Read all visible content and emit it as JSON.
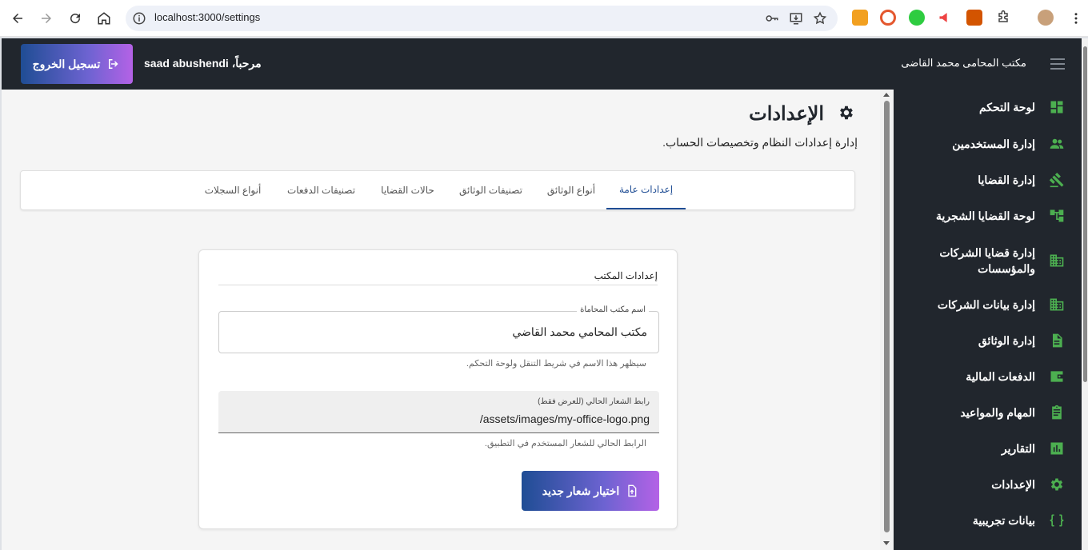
{
  "browser": {
    "url": "localhost:3000/settings"
  },
  "header": {
    "app_title": "مكتب المحامى محمد القاضى",
    "welcome": "مرحباً، saad abushendi",
    "logout_label": "تسجيل الخروج"
  },
  "sidebar": {
    "items": [
      {
        "label": "لوحة التحكم",
        "icon": "dashboard-icon"
      },
      {
        "label": "إدارة المستخدمين",
        "icon": "people-icon"
      },
      {
        "label": "إدارة القضايا",
        "icon": "gavel-icon"
      },
      {
        "label": "لوحة القضايا الشجرية",
        "icon": "account-tree-icon"
      },
      {
        "label": "إدارة قضايا الشركات والمؤسسات",
        "icon": "business-icon"
      },
      {
        "label": "إدارة بيانات الشركات",
        "icon": "business-icon"
      },
      {
        "label": "إدارة الوثائق",
        "icon": "document-icon"
      },
      {
        "label": "الدفعات المالية",
        "icon": "wallet-icon"
      },
      {
        "label": "المهام والمواعيد",
        "icon": "clipboard-icon"
      },
      {
        "label": "التقارير",
        "icon": "bar-chart-icon"
      },
      {
        "label": "الإعدادات",
        "icon": "settings-icon"
      },
      {
        "label": "بيانات تجريبية",
        "icon": "data-object-icon"
      }
    ]
  },
  "page": {
    "title": "الإعدادات",
    "subtitle": "إدارة إعدادات النظام وتخصيصات الحساب."
  },
  "tabs": [
    {
      "label": "إعدادات عامة",
      "active": true
    },
    {
      "label": "أنواع الوثائق"
    },
    {
      "label": "تصنيفات الوثائق"
    },
    {
      "label": "حالات القضايا"
    },
    {
      "label": "تصنيفات الدفعات"
    },
    {
      "label": "أنواع السجلات"
    }
  ],
  "office_settings": {
    "heading": "إعدادات المكتب",
    "name_label": "اسم مكتب المحاماة",
    "name_value": "مكتب المحامي محمد القاضي",
    "name_helper": "سيظهر هذا الاسم في شريط التنقل ولوحة التحكم.",
    "logo_label": "رابط الشعار الحالي (للعرض فقط)",
    "logo_value": "/assets/images/my-office-logo.png",
    "logo_helper": "الرابط الحالي للشعار المستخدم في التطبيق.",
    "upload_label": "اختيار شعار جديد"
  },
  "colors": {
    "sidebar_bg": "#21262d",
    "accent_green": "#4caf50",
    "gradient_start": "#1f4d94",
    "gradient_end": "#b462e6"
  }
}
